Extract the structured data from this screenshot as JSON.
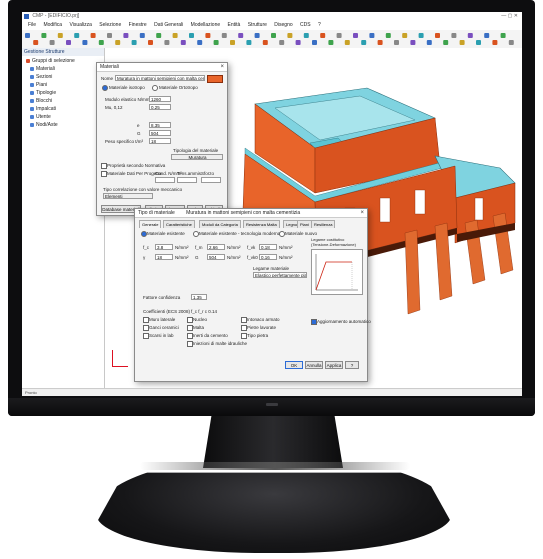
{
  "app": {
    "title": "CMP - [EDIFICIO.prj]",
    "window_controls": "— ▢ ✕",
    "menu": [
      "File",
      "Modifica",
      "Visualizza",
      "Selezione",
      "Finestre",
      "Dati Generali",
      "Modellazione",
      "Entità",
      "Strutture",
      "Disegno",
      "CDS",
      "?"
    ],
    "status": "Pronto"
  },
  "left_panel": {
    "title": "Gestione Strutture",
    "items": [
      {
        "label": "Gruppi di selezione",
        "color": "#d94c2a"
      },
      {
        "label": "Materiali",
        "color": "#4a7fd4"
      },
      {
        "label": "Sezioni",
        "color": "#4a7fd4"
      },
      {
        "label": "Piani",
        "color": "#4a7fd4"
      },
      {
        "label": "Tipologie",
        "color": "#4a7fd4"
      },
      {
        "label": "Blocchi",
        "color": "#4a7fd4"
      },
      {
        "label": "Impalcati",
        "color": "#4a7fd4"
      },
      {
        "label": "Utente",
        "color": "#4a7fd4"
      },
      {
        "label": "Nodi/Aste",
        "color": "#4a7fd4"
      }
    ]
  },
  "dialog_materiali": {
    "title": "Materiali",
    "nome_label": "Nome",
    "nome_value": "Muratura in mattoni semipieni con malta cementizia",
    "radio_1": "Materiale isotropo",
    "radio_2": "Materiale Ortotropo",
    "rows": [
      {
        "label": "Modulo elastico N/mm²",
        "value": "1260"
      },
      {
        "label": "Mu, 0,12",
        "value": "0.25"
      },
      {
        "label": "e",
        "value": "8.35"
      },
      {
        "label": "G",
        "value": "504"
      },
      {
        "label": "Peso specifico t/m³",
        "value": "18"
      }
    ],
    "tipologia_label": "Tipologia del materiale",
    "tipologia_value": "Muratura",
    "check_1": "Proprietà secondo Normativa",
    "check_2": "Materiale Dati Per Progetto",
    "extra_labels": [
      "Cond. N/mm²",
      "Tens.ammis.",
      "Sforzo"
    ],
    "footer_note": "Tipo correlazione con valore meccanico",
    "footer_value": "Elementi",
    "buttons": [
      "Database materiali",
      "Elimina",
      "Ricercaprov",
      "Salva",
      "Chiudi"
    ]
  },
  "dialog_tipo": {
    "title": "Tipo di materiale",
    "title_value": "Muratura in mattoni semipieni con malta cementizia",
    "tabs": [
      "Generale",
      "Caratteristiche",
      "Moduli da Categoria",
      "Resistenza Malta",
      "Legno",
      "Piani",
      "Resilienza"
    ],
    "radio_1": "Materiale esistente",
    "radio_2": "Materiale esistente - tecnologia moderna",
    "radio_3": "Materiale nuovo",
    "params": [
      {
        "label": "f_c",
        "value": "3.8",
        "unit": "N/mm²"
      },
      {
        "label": "f_m",
        "value": "2.66",
        "unit": "N/mm²"
      },
      {
        "label": "f_vk",
        "value": "0.18",
        "unit": "N/mm²"
      },
      {
        "label": "γ",
        "value": "18",
        "unit": "N/mm²"
      },
      {
        "label": "G",
        "value": "504",
        "unit": "N/mm²"
      },
      {
        "label": "f_vk0",
        "value": "0.16",
        "unit": "N/mm²"
      }
    ],
    "diagram_label": "Legame costitutivo (Tensione-Deformazione)",
    "legame_label": "Legame materiale",
    "legame_value": "Elastico perfettamente plastico",
    "fattore_label": "Fattore confidenza",
    "fattore_value": "1.35",
    "coeff_label": "Coefficienti (ECS 2008)",
    "coeff_value": "f_c f_r c 0.14",
    "checks": [
      "Muro laterale",
      "Ganci ceramici",
      "Scarsi in lab",
      "Nucleo",
      "Malta",
      "Inerti da cemento",
      "Iniezioni di malte idrauliche",
      "Intonaco armato",
      "Pietre lavorate",
      "Tipo pietra"
    ],
    "check_right": "Aggiornamento automatico",
    "buttons": [
      "OK",
      "Annulla",
      "Applica",
      "?"
    ]
  }
}
